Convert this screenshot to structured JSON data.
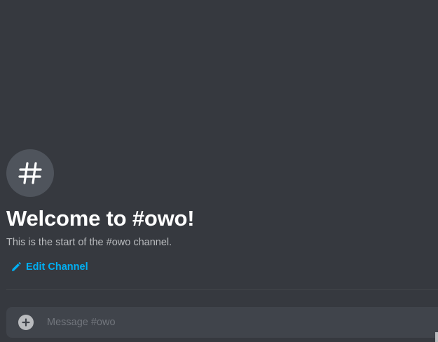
{
  "channel": {
    "name": "owo",
    "icon": "hashtag-icon"
  },
  "welcome": {
    "title": "Welcome to #owo!",
    "subtitle": "This is the start of the #owo channel."
  },
  "actions": {
    "edit_channel_label": "Edit Channel",
    "edit_channel_icon": "pencil-icon"
  },
  "composer": {
    "placeholder": "Message #owo",
    "value": "",
    "attach_icon": "plus-circle-icon"
  },
  "colors": {
    "background": "#36393f",
    "accent_link": "#00b0f4",
    "composer_bg": "#40444b"
  }
}
